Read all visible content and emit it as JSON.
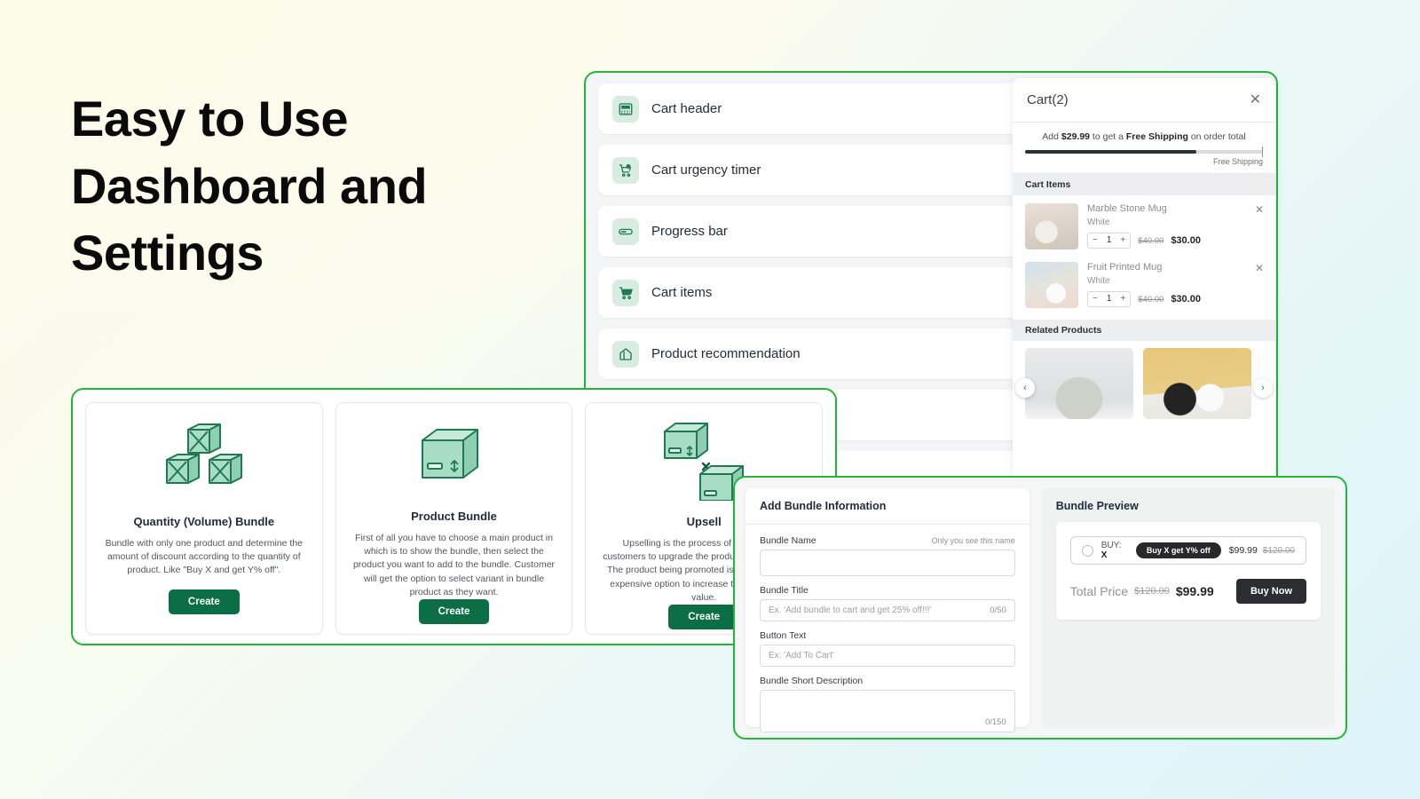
{
  "headline": {
    "line1": "Easy to Use",
    "line2": "Dashboard and",
    "line3": "Settings"
  },
  "theme": {
    "accent_green": "#22b539",
    "brand_dark_green": "#0b6e45",
    "toggle_on": "#0b7d48",
    "icon_tile_bg": "#d9ece1",
    "dark_button": "#2b2d30"
  },
  "settings": {
    "rows": [
      {
        "label": "Cart header",
        "icon": "cart-header-icon",
        "has_toggle": false,
        "toggle_on": false,
        "has_drag": false
      },
      {
        "label": "Cart urgency timer",
        "icon": "cart-timer-icon",
        "has_toggle": true,
        "toggle_on": false,
        "has_drag": false
      },
      {
        "label": "Progress bar",
        "icon": "progress-bar-icon",
        "has_toggle": true,
        "toggle_on": true,
        "has_drag": false
      },
      {
        "label": "Cart items",
        "icon": "shopping-cart-icon",
        "has_toggle": false,
        "toggle_on": false,
        "has_drag": true
      },
      {
        "label": "Product recommendation",
        "icon": "product-tag-icon",
        "has_toggle": true,
        "toggle_on": true,
        "has_drag": true
      },
      {
        "label": "",
        "icon": "",
        "has_toggle": true,
        "toggle_on": true,
        "has_drag": true
      },
      {
        "label": "",
        "icon": "",
        "has_toggle": true,
        "toggle_on": false,
        "has_drag": true
      }
    ]
  },
  "cart": {
    "title": "Cart(2)",
    "close_icon": "close-icon",
    "shipping": {
      "prefix": "Add ",
      "amount": "$29.99",
      "middle": " to get a ",
      "offer": "Free Shipping",
      "suffix": " on order total",
      "caption": "Free Shipping",
      "progress_percent": 72
    },
    "items_header": "Cart Items",
    "items": [
      {
        "name": "Marble Stone Mug",
        "variant": "White",
        "qty": "1",
        "price_old": "$40.00",
        "price_new": "$30.00",
        "minus": "−",
        "plus": "+",
        "remove_icon": "close-icon"
      },
      {
        "name": "Fruit Printed Mug",
        "variant": "White",
        "qty": "1",
        "price_old": "$40.00",
        "price_new": "$30.00",
        "minus": "−",
        "plus": "+",
        "remove_icon": "close-icon"
      }
    ],
    "related_header": "Related Products",
    "carousel": {
      "prev": "‹",
      "next": "›"
    }
  },
  "bundle_types": {
    "cards": [
      {
        "title": "Quantity (Volume) Bundle",
        "desc": "Bundle with only one product and determine the amount of discount according to the quantity of product. Like \"Buy X and get Y% off\".",
        "button": "Create",
        "art": "stacked-crates-illustration"
      },
      {
        "title": "Product Bundle",
        "desc": "First of all you have to choose a main product in which is to show the bundle, then select the product you want to add to the bundle. Customer will get the option to select variant in bundle product as they want.",
        "button": "Create",
        "art": "single-box-illustration"
      },
      {
        "title": "Upsell",
        "desc": "Upselling is the process of encouraging customers to upgrade the product they're buying. The product being promoted is typically a more expensive option to increase the overall order value.",
        "button": "Create",
        "art": "two-boxes-multiply-illustration"
      }
    ]
  },
  "bundle_form": {
    "heading": "Add Bundle Information",
    "fields": {
      "name": {
        "label": "Bundle Name",
        "hint": "Only you see this name",
        "placeholder": "",
        "value": ""
      },
      "title": {
        "label": "Bundle Title",
        "placeholder": "Ex. 'Add bundle to cart and get 25% off!!!'",
        "counter": "0/50"
      },
      "button_text": {
        "label": "Button Text",
        "placeholder": "Ex. 'Add To Cart'"
      },
      "short_description": {
        "label": "Bundle Short Description",
        "counter": "0/150"
      }
    }
  },
  "bundle_preview": {
    "heading": "Bundle Preview",
    "offer": {
      "buy_label": "BUY:",
      "buy_value": "X",
      "badge": "Buy X get Y% off",
      "price_now": "$99.99",
      "price_was": "$120.00"
    },
    "total": {
      "label": "Total Price",
      "was": "$120.00",
      "now": "$99.99"
    },
    "buy_button": "Buy Now"
  }
}
